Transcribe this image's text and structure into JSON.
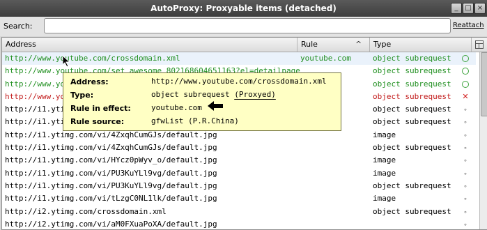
{
  "window": {
    "title": "AutoProxy: Proxyable items (detached)",
    "buttons": [
      "_",
      "□",
      "×"
    ]
  },
  "search": {
    "label": "Search:",
    "value": "",
    "placeholder": ""
  },
  "reattach_label": "Reattach",
  "columns": {
    "address": "Address",
    "rule": "Rule",
    "type": "Type"
  },
  "rows": [
    {
      "address": "http://www.youtube.com/crossdomain.xml",
      "rule": "youtube.com",
      "type": "object subrequest",
      "status": "matched"
    },
    {
      "address": "http://www.youtube.com/set_awesome_802168604651163?el=detailpage",
      "rule": "",
      "type": "object subrequest",
      "status": "matched"
    },
    {
      "address": "http://www.youtube.com/watch?v=...",
      "rule": "",
      "type": "object subrequest",
      "status": "matched"
    },
    {
      "address": "http://www.youtube.com/...",
      "rule": "...com",
      "type": "object subrequest",
      "status": "blocked"
    },
    {
      "address": "http://i1.ytimg.com/...",
      "rule": "",
      "type": "object subrequest",
      "status": "none"
    },
    {
      "address": "http://i1.ytimg.com/...",
      "rule": "",
      "type": "object subrequest",
      "status": "none"
    },
    {
      "address": "http://i1.ytimg.com/vi/4ZxqhCumGJs/default.jpg",
      "rule": "",
      "type": "image",
      "status": "none"
    },
    {
      "address": "http://i1.ytimg.com/vi/4ZxqhCumGJs/default.jpg",
      "rule": "",
      "type": "object subrequest",
      "status": "none"
    },
    {
      "address": "http://i1.ytimg.com/vi/HYcz0pWyv_o/default.jpg",
      "rule": "",
      "type": "image",
      "status": "none"
    },
    {
      "address": "http://i1.ytimg.com/vi/PU3KuYLl9vg/default.jpg",
      "rule": "",
      "type": "image",
      "status": "none"
    },
    {
      "address": "http://i1.ytimg.com/vi/PU3KuYLl9vg/default.jpg",
      "rule": "",
      "type": "object subrequest",
      "status": "none"
    },
    {
      "address": "http://i1.ytimg.com/vi/tLzgC0NL1lk/default.jpg",
      "rule": "",
      "type": "image",
      "status": "none"
    },
    {
      "address": "http://i2.ytimg.com/crossdomain.xml",
      "rule": "",
      "type": "object subrequest",
      "status": "none"
    },
    {
      "address": "http://i2.ytimg.com/vi/aM0FXuaPoXA/default.jpg",
      "rule": "",
      "type": "",
      "status": "none"
    }
  ],
  "tooltip": {
    "address_label": "Address:",
    "address_value": "http://www.youtube.com/crossdomain.xml",
    "type_label": "Type:",
    "type_value": "object subrequest",
    "type_note": "(Proxyed)",
    "rule_label": "Rule in effect:",
    "rule_value": "youtube.com",
    "source_label": "Rule source:",
    "source_value": "gfwList (P.R.China)"
  },
  "colors": {
    "matched": "#1f8f1f",
    "blocked": "#c21b1b",
    "tooltip_bg": "#ffffc4"
  }
}
